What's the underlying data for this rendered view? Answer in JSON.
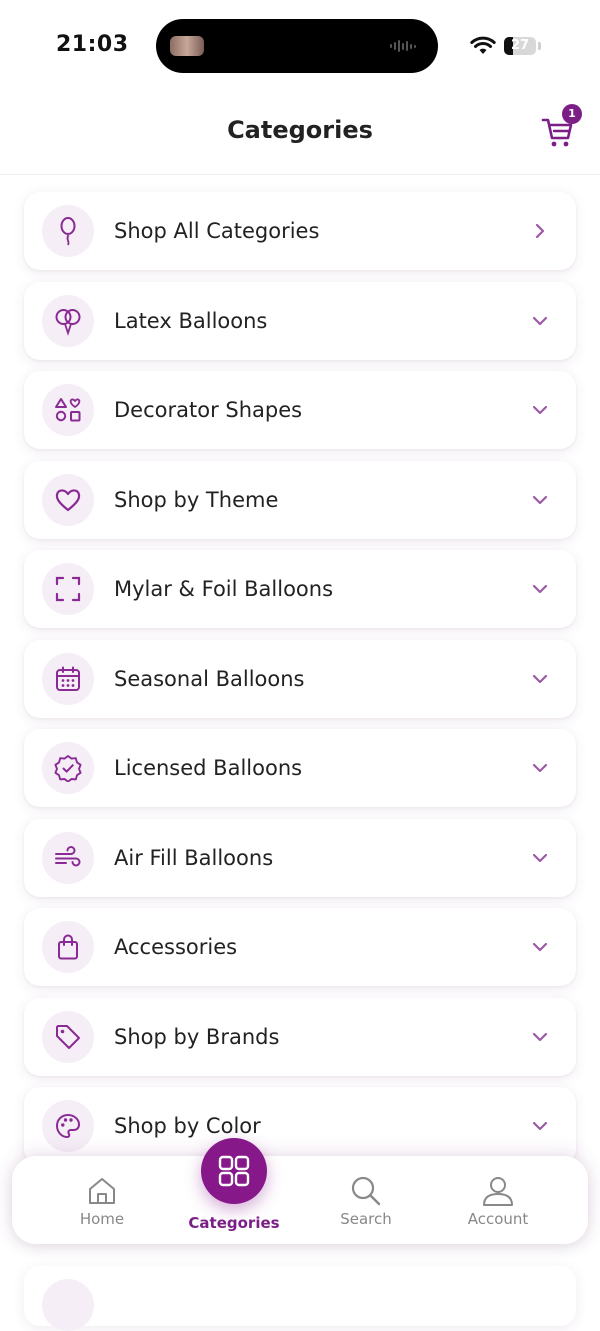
{
  "status_bar": {
    "time": "21:03",
    "battery": "27",
    "battery_level": 0.27
  },
  "header": {
    "title": "Categories",
    "cart_count": "1"
  },
  "categories": [
    {
      "label": "Shop All Categories",
      "icon": "balloon-icon",
      "arrow": "chevron-right-icon"
    },
    {
      "label": "Latex Balloons",
      "icon": "balloons-icon",
      "arrow": "chevron-down-icon"
    },
    {
      "label": "Decorator Shapes",
      "icon": "shapes-icon",
      "arrow": "chevron-down-icon"
    },
    {
      "label": "Shop by Theme",
      "icon": "heart-icon",
      "arrow": "chevron-down-icon"
    },
    {
      "label": "Mylar & Foil Balloons",
      "icon": "frame-icon",
      "arrow": "chevron-down-icon"
    },
    {
      "label": "Seasonal Balloons",
      "icon": "calendar-icon",
      "arrow": "chevron-down-icon"
    },
    {
      "label": "Licensed Balloons",
      "icon": "badge-check-icon",
      "arrow": "chevron-down-icon"
    },
    {
      "label": "Air Fill Balloons",
      "icon": "wind-icon",
      "arrow": "chevron-down-icon"
    },
    {
      "label": "Accessories",
      "icon": "bag-icon",
      "arrow": "chevron-down-icon"
    },
    {
      "label": "Shop by Brands",
      "icon": "tag-icon",
      "arrow": "chevron-down-icon"
    },
    {
      "label": "Shop by Color",
      "icon": "palette-icon",
      "arrow": "chevron-down-icon"
    }
  ],
  "bottom_nav": {
    "home": "Home",
    "categories": "Categories",
    "search": "Search",
    "account": "Account"
  },
  "colors": {
    "accent": "#7b1f86",
    "icon_bg": "#f5eef6",
    "chevron": "#9b5aa5"
  }
}
